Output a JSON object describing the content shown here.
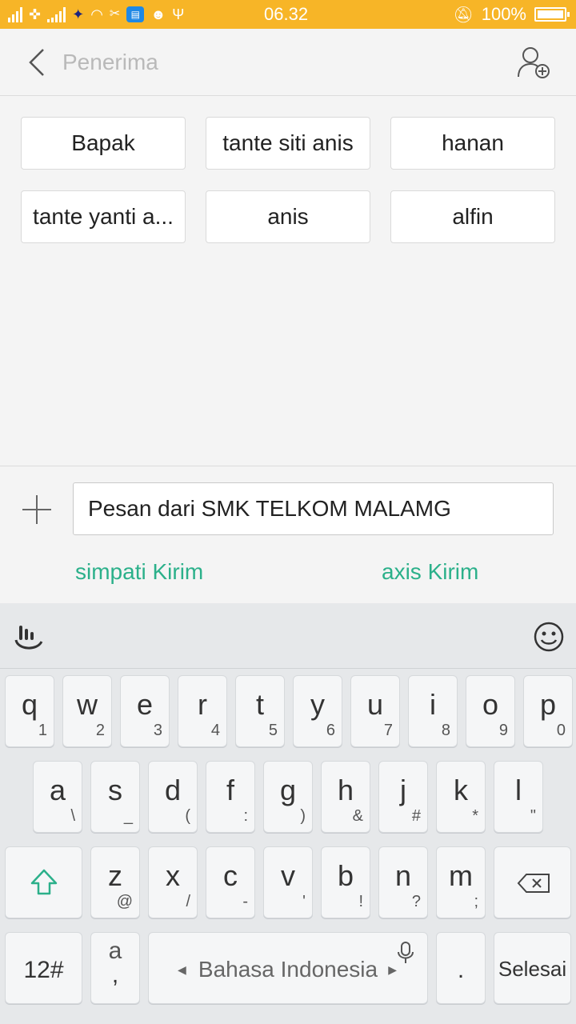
{
  "status_bar": {
    "time": "06.32",
    "battery": "100%"
  },
  "header": {
    "title": "Penerima"
  },
  "recipients": [
    "Bapak",
    "tante siti anis",
    "hanan",
    "tante yanti a...",
    "anis",
    "alfin"
  ],
  "compose": {
    "message": "Pesan dari SMK TELKOM MALAMG",
    "send_simpati": "simpati Kirim",
    "send_axis": "axis Kirim"
  },
  "keyboard": {
    "row1": [
      {
        "k": "q",
        "s": "1"
      },
      {
        "k": "w",
        "s": "2"
      },
      {
        "k": "e",
        "s": "3"
      },
      {
        "k": "r",
        "s": "4"
      },
      {
        "k": "t",
        "s": "5"
      },
      {
        "k": "y",
        "s": "6"
      },
      {
        "k": "u",
        "s": "7"
      },
      {
        "k": "i",
        "s": "8"
      },
      {
        "k": "o",
        "s": "9"
      },
      {
        "k": "p",
        "s": "0"
      }
    ],
    "row2": [
      {
        "k": "a",
        "s": "\\"
      },
      {
        "k": "s",
        "s": "_"
      },
      {
        "k": "d",
        "s": "("
      },
      {
        "k": "f",
        "s": ":"
      },
      {
        "k": "g",
        "s": ")"
      },
      {
        "k": "h",
        "s": "&"
      },
      {
        "k": "j",
        "s": "#"
      },
      {
        "k": "k",
        "s": "*"
      },
      {
        "k": "l",
        "s": "\""
      }
    ],
    "row3": [
      {
        "k": "z",
        "s": "@"
      },
      {
        "k": "x",
        "s": "/"
      },
      {
        "k": "c",
        "s": "-"
      },
      {
        "k": "v",
        "s": "'"
      },
      {
        "k": "b",
        "s": "!"
      },
      {
        "k": "n",
        "s": "?"
      },
      {
        "k": "m",
        "s": ";"
      }
    ],
    "symbols_key": "12#",
    "punct_key_top": "a",
    "punct_key_bottom": ",",
    "space_label": "Bahasa Indonesia",
    "period_key": ".",
    "done_key": "Selesai"
  }
}
